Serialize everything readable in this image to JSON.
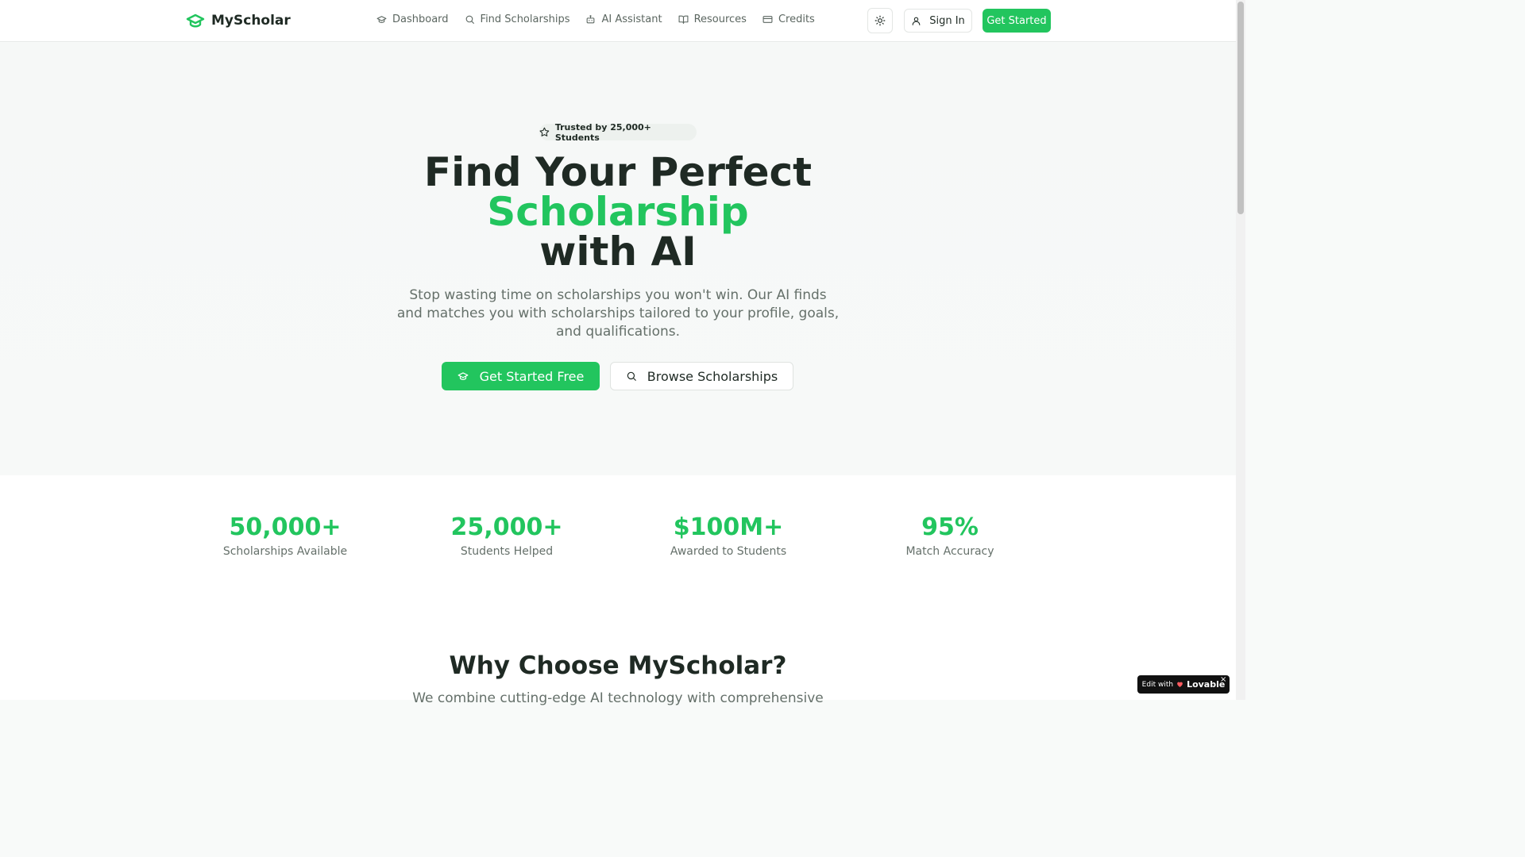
{
  "header": {
    "brand": "MyScholar",
    "nav": [
      {
        "label": "Dashboard",
        "icon": "graduation-cap-icon"
      },
      {
        "label": "Find Scholarships",
        "icon": "search-icon"
      },
      {
        "label": "AI Assistant",
        "icon": "bot-icon"
      },
      {
        "label": "Resources",
        "icon": "book-open-icon"
      },
      {
        "label": "Credits",
        "icon": "credit-card-icon"
      }
    ],
    "sign_in": "Sign In",
    "get_started": "Get Started"
  },
  "hero": {
    "badge": "Trusted by 25,000+ Students",
    "title_line1": "Find Your Perfect",
    "title_accent": "Scholarship",
    "title_line3": "with AI",
    "subtitle": "Stop wasting time on scholarships you won't win. Our AI finds and matches you with scholarships tailored to your profile, goals, and qualifications.",
    "cta_primary": "Get Started Free",
    "cta_secondary": "Browse Scholarships"
  },
  "stats": [
    {
      "value": "50,000+",
      "label": "Scholarships Available"
    },
    {
      "value": "25,000+",
      "label": "Students Helped"
    },
    {
      "value": "$100M+",
      "label": "Awarded to Students"
    },
    {
      "value": "95%",
      "label": "Match Accuracy"
    }
  ],
  "why": {
    "title": "Why Choose MyScholar?",
    "subtitle": "We combine cutting-edge AI technology with comprehensive"
  },
  "lovable": {
    "prefix": "Edit with",
    "brand": "Lovable",
    "close": "×"
  },
  "colors": {
    "accent": "#22c55e",
    "text": "#1f2a24",
    "muted": "#65706a"
  }
}
